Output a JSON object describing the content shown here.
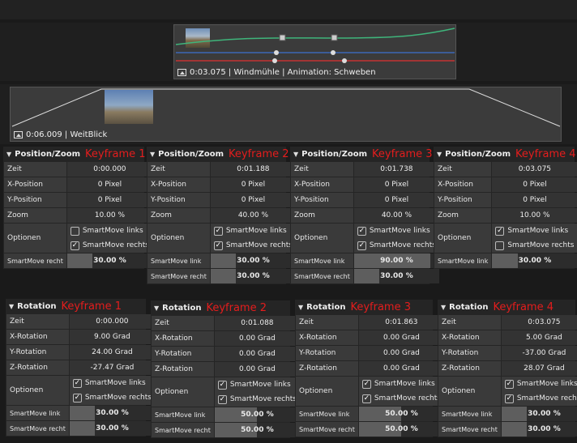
{
  "timeline": {
    "clip1": {
      "label": "0:03.075 | Windmühle | Animation: Schweben"
    },
    "clip2": {
      "label": "0:06.009 | WeitBlick"
    }
  },
  "labels": {
    "zeit": "Zeit",
    "xpos": "X-Position",
    "ypos": "Y-Position",
    "zoom": "Zoom",
    "xrot": "X-Rotation",
    "yrot": "Y-Rotation",
    "zrot": "Z-Rotation",
    "optionen": "Optionen",
    "sm_links": "SmartMove links",
    "sm_rechts": "SmartMove rechts",
    "sm_link_short": "SmartMove link",
    "sm_recht_short": "SmartMove recht"
  },
  "position_panels": [
    {
      "title": "Position/Zoom",
      "keyframe": "Keyframe 1",
      "zeit": "0:00.000",
      "x": "0 Pixel",
      "y": "0 Pixel",
      "zoom": "10.00 %",
      "sm_links": false,
      "sm_rechts": true,
      "slider1_label": "SmartMove recht",
      "slider1": "30.00 %",
      "slider1_frac": 0.3
    },
    {
      "title": "Position/Zoom",
      "keyframe": "Keyframe 2",
      "zeit": "0:01.188",
      "x": "0 Pixel",
      "y": "0 Pixel",
      "zoom": "40.00 %",
      "sm_links": true,
      "sm_rechts": true,
      "slider1_label": "SmartMove link",
      "slider1": "30.00 %",
      "slider1_frac": 0.3,
      "slider2_label": "SmartMove recht",
      "slider2": "30.00 %",
      "slider2_frac": 0.3
    },
    {
      "title": "Position/Zoom",
      "keyframe": "Keyframe 3",
      "zeit": "0:01.738",
      "x": "0 Pixel",
      "y": "0 Pixel",
      "zoom": "40.00 %",
      "sm_links": true,
      "sm_rechts": true,
      "slider1_label": "SmartMove link",
      "slider1": "90.00 %",
      "slider1_frac": 0.9,
      "slider2_label": "SmartMove recht",
      "slider2": "30.00 %",
      "slider2_frac": 0.3
    },
    {
      "title": "Position/Zoom",
      "keyframe": "Keyframe 4",
      "zeit": "0:03.075",
      "x": "0 Pixel",
      "y": "0 Pixel",
      "zoom": "10.00 %",
      "sm_links": true,
      "sm_rechts": false,
      "slider1_label": "SmartMove link",
      "slider1": "30.00 %",
      "slider1_frac": 0.3
    }
  ],
  "rotation_panels": [
    {
      "title": "Rotation",
      "keyframe": "Keyframe 1",
      "zeit": "0:00.000",
      "xr": "9.00 Grad",
      "yr": "24.00 Grad",
      "zr": "-27.47 Grad",
      "sm_links": true,
      "sm_rechts": true,
      "s1": "30.00 %",
      "s1f": 0.3,
      "s2": "30.00 %",
      "s2f": 0.3
    },
    {
      "title": "Rotation",
      "keyframe": "Keyframe 2",
      "zeit": "0:01.088",
      "xr": "0.00 Grad",
      "yr": "0.00 Grad",
      "zr": "0.00 Grad",
      "sm_links": true,
      "sm_rechts": true,
      "s1": "50.00 %",
      "s1f": 0.5,
      "s2": "50.00 %",
      "s2f": 0.5
    },
    {
      "title": "Rotation",
      "keyframe": "Keyframe 3",
      "zeit": "0:01.863",
      "xr": "0.00 Grad",
      "yr": "0.00 Grad",
      "zr": "0.00 Grad",
      "sm_links": true,
      "sm_rechts": true,
      "s1": "50.00 %",
      "s1f": 0.5,
      "s2": "50.00 %",
      "s2f": 0.5
    },
    {
      "title": "Rotation",
      "keyframe": "Keyframe 4",
      "zeit": "0:03.075",
      "xr": "5.00 Grad",
      "yr": "-37.00 Grad",
      "zr": "28.07 Grad",
      "sm_links": true,
      "sm_rechts": true,
      "s1": "30.00 %",
      "s1f": 0.3,
      "s2": "30.00 %",
      "s2f": 0.3
    }
  ]
}
